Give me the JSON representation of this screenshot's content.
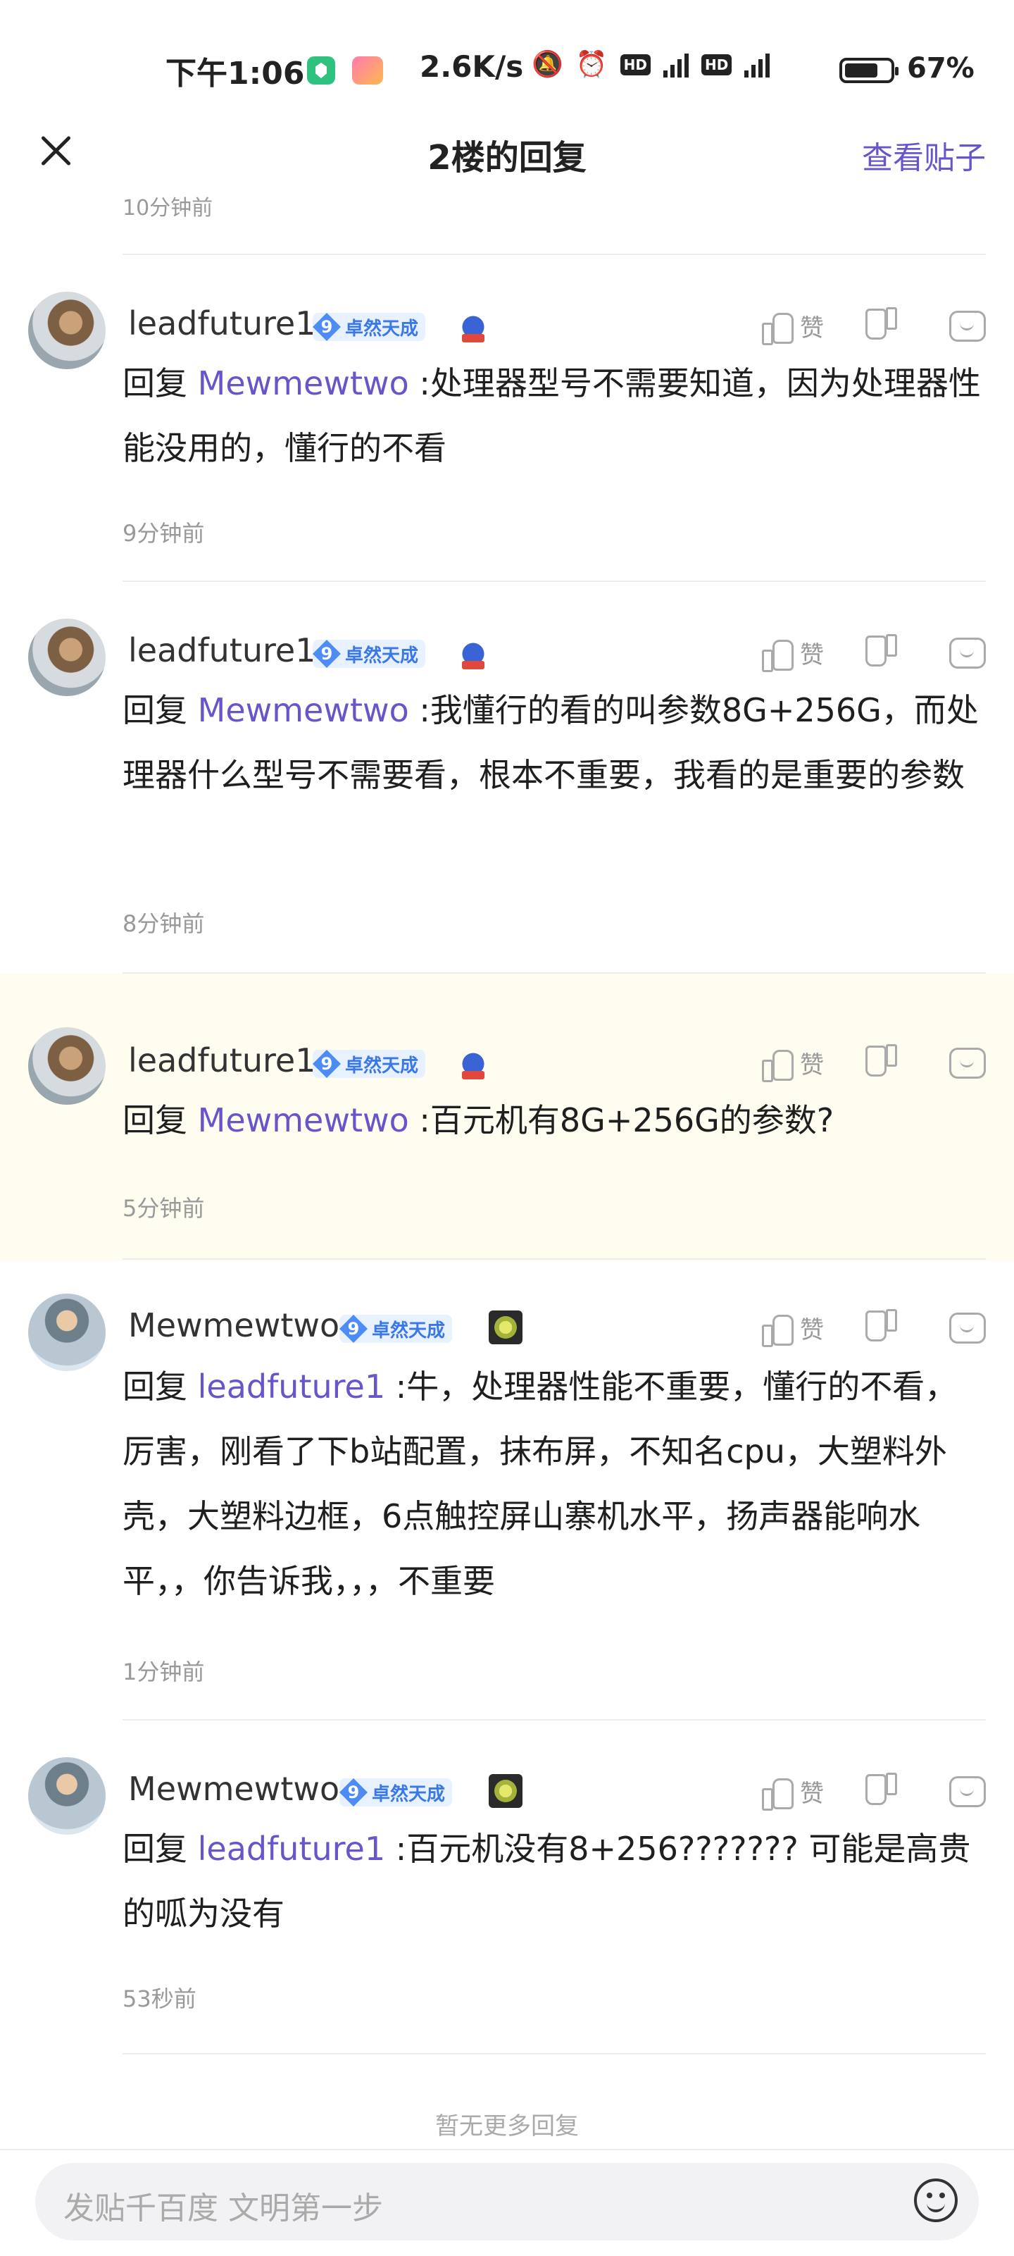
{
  "status_bar": {
    "time": "下午1:06",
    "net_speed": "2.6K/s",
    "battery": "67%"
  },
  "header": {
    "title": "2楼的回复",
    "view_post": "查看贴子",
    "top_time": "10分钟前"
  },
  "replies": [
    {
      "username": "leadfuture1",
      "level": "9",
      "level_title": "卓然天成",
      "like_label": "赞",
      "reply_prefix": "回复",
      "mention": "Mewmewtwo",
      "text": " :处理器型号不需要知道，因为处理器性能没用的，懂行的不看",
      "time": "9分钟前"
    },
    {
      "username": "leadfuture1",
      "level": "9",
      "level_title": "卓然天成",
      "like_label": "赞",
      "reply_prefix": "回复",
      "mention": "Mewmewtwo",
      "text": " :我懂行的看的叫参数8G+256G，而处理器什么型号不需要看，根本不重要，我看的是重要的参数",
      "time": "8分钟前"
    },
    {
      "username": "leadfuture1",
      "level": "9",
      "level_title": "卓然天成",
      "like_label": "赞",
      "reply_prefix": "回复",
      "mention": "Mewmewtwo",
      "text": " :百元机有8G+256G的参数?",
      "time": "5分钟前"
    },
    {
      "username": "Mewmewtwo",
      "level": "9",
      "level_title": "卓然天成",
      "like_label": "赞",
      "reply_prefix": "回复",
      "mention": "leadfuture1",
      "text": " :牛，处理器性能不重要，懂行的不看，厉害，刚看了下b站配置，抹布屏，不知名cpu，大塑料外壳，大塑料边框，6点触控屏山寨机水平，扬声器能响水平，，你告诉我，，，不重要",
      "time": "1分钟前"
    },
    {
      "username": "Mewmewtwo",
      "level": "9",
      "level_title": "卓然天成",
      "like_label": "赞",
      "reply_prefix": "回复",
      "mention": "leadfuture1",
      "text": " :百元机没有8+256??????? 可能是高贵的呱为没有",
      "time": "53秒前"
    }
  ],
  "footer": {
    "no_more": "暂无更多回复",
    "input_placeholder": "发贴千百度 文明第一步"
  },
  "colors": {
    "accent": "#6a54c9",
    "highlight_bg": "#fffdf0",
    "badge_blue": "#4d8bf5"
  }
}
